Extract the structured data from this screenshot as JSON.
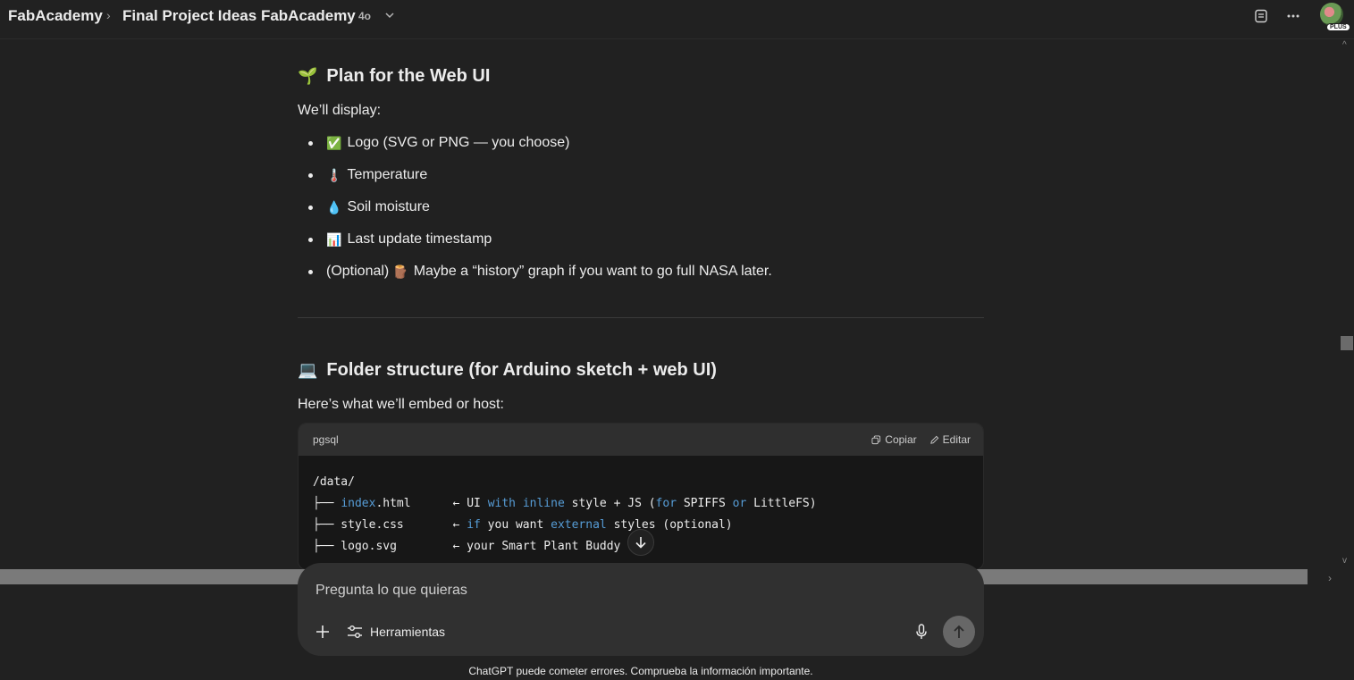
{
  "header": {
    "breadcrumb_root": "FabAcademy",
    "breadcrumb_separator": "›",
    "project_title": "Final Project Ideas FabAcademy",
    "model_badge": "4o",
    "avatar_badge": "PLUS",
    "icons": [
      "chevron-down-icon",
      "notes-icon",
      "more-icon",
      "avatar"
    ]
  },
  "section1": {
    "emoji": "🌱",
    "heading": "Plan for the Web UI",
    "intro": "We’ll display:",
    "items": [
      {
        "emoji": "✅",
        "text": "Logo (SVG or PNG — you choose)"
      },
      {
        "emoji": "🌡️",
        "text": "Temperature"
      },
      {
        "emoji": "💧",
        "text": "Soil moisture"
      },
      {
        "emoji": "📊",
        "text": "Last update timestamp"
      },
      {
        "emoji": "🪵",
        "prefix": "(Optional)",
        "text": "Maybe a “history” graph if you want to go full NASA later."
      }
    ]
  },
  "section2": {
    "emoji": "💻",
    "heading": "Folder structure (for Arduino sketch + web UI)",
    "intro": "Here’s what we’ll embed or host:"
  },
  "codeblock": {
    "language": "pgsql",
    "copy_label": "Copiar",
    "edit_label": "Editar",
    "lines": [
      "/data/",
      "├── index.html      ← UI with inline style + JS (for SPIFFS or LittleFS)",
      "├── style.css       ← if you want external styles (optional)",
      "├── logo.svg        ← your Smart Plant Buddy l"
    ]
  },
  "composer": {
    "placeholder": "Pregunta lo que quieras",
    "tools_label": "Herramientas"
  },
  "footer": {
    "note": "ChatGPT puede cometer errores. Comprueba la información importante."
  },
  "colors": {
    "background": "#212121",
    "composer": "#303030",
    "code_bg": "#171717",
    "code_header": "#2f2f2f",
    "keyword": "#569cd6"
  }
}
